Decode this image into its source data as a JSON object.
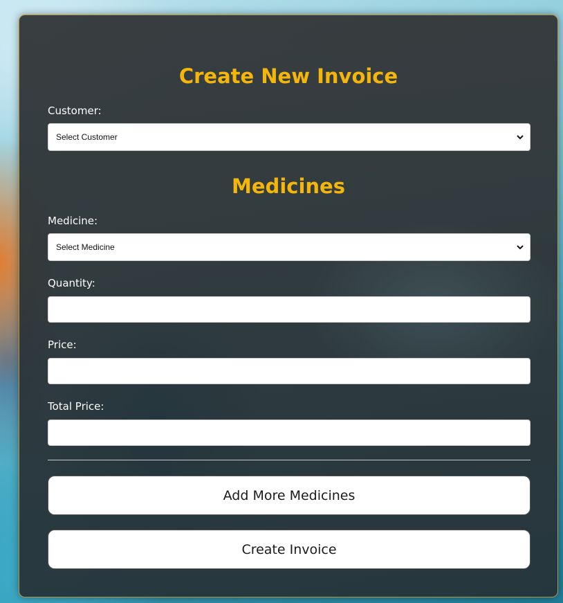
{
  "form": {
    "title": "Create New Invoice",
    "customer_label": "Customer:",
    "customer_select": "Select Customer",
    "medicines_heading": "Medicines",
    "medicine_label": "Medicine:",
    "medicine_select": "Select Medicine",
    "quantity_label": "Quantity:",
    "quantity_value": "",
    "price_label": "Price:",
    "price_value": "",
    "total_price_label": "Total Price:",
    "total_price_value": "",
    "add_more_button": "Add More Medicines",
    "create_button": "Create Invoice"
  },
  "icons": {
    "select_arrow": "chevron-down-icon"
  },
  "colors": {
    "heading": "#f5b60c",
    "card_border": "#b8973f",
    "card_background": "#34383a"
  }
}
